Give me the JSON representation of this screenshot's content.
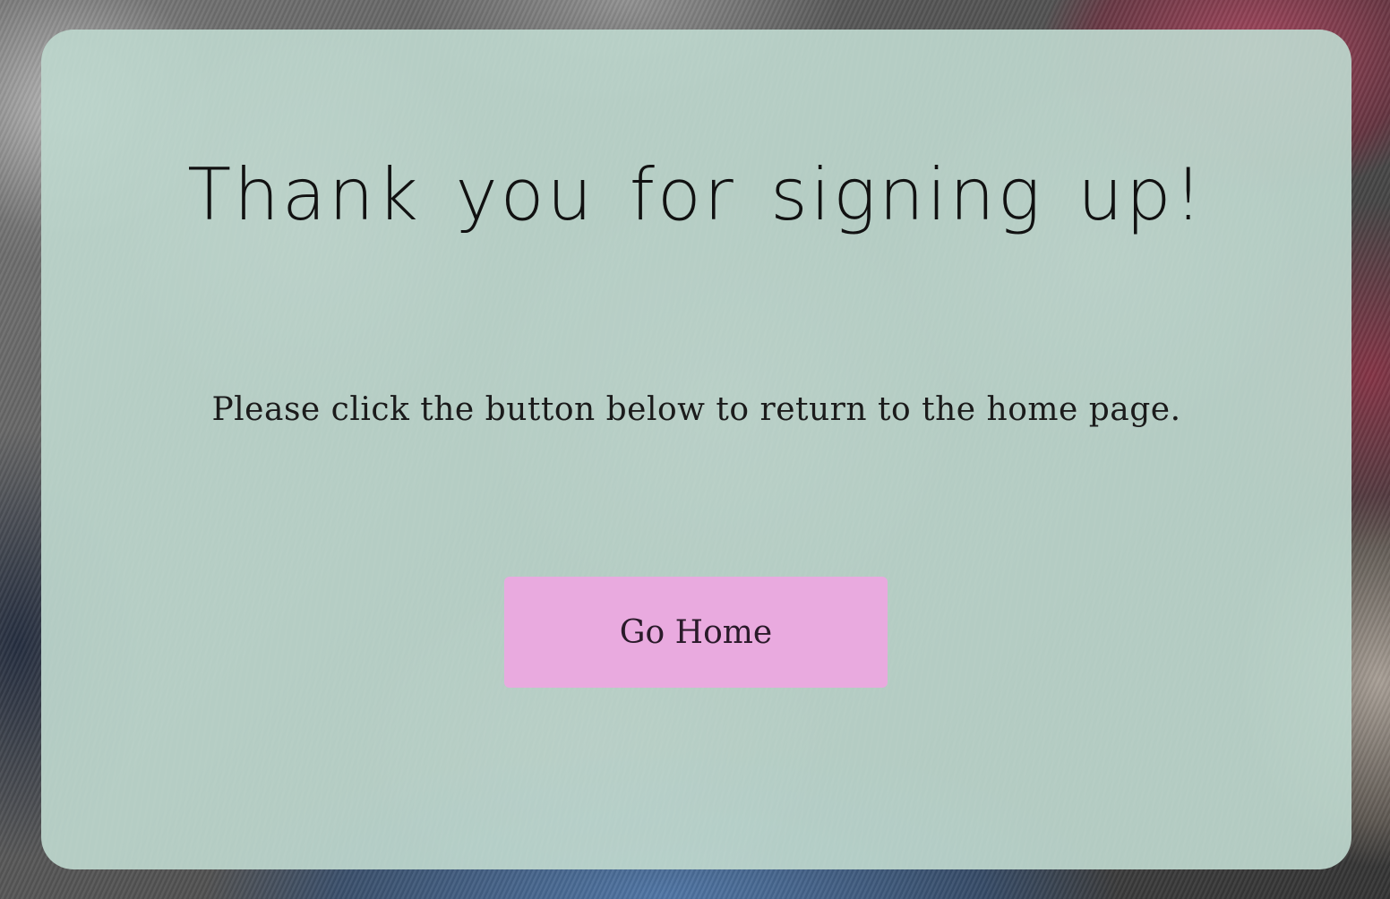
{
  "confirmation": {
    "title": "Thank you for signing up!",
    "message": "Please click the button below to return to the home page.",
    "button_label": "Go Home"
  },
  "colors": {
    "card_background": "#bbd4cb",
    "button_background": "#e9aadf",
    "text": "#111111"
  }
}
